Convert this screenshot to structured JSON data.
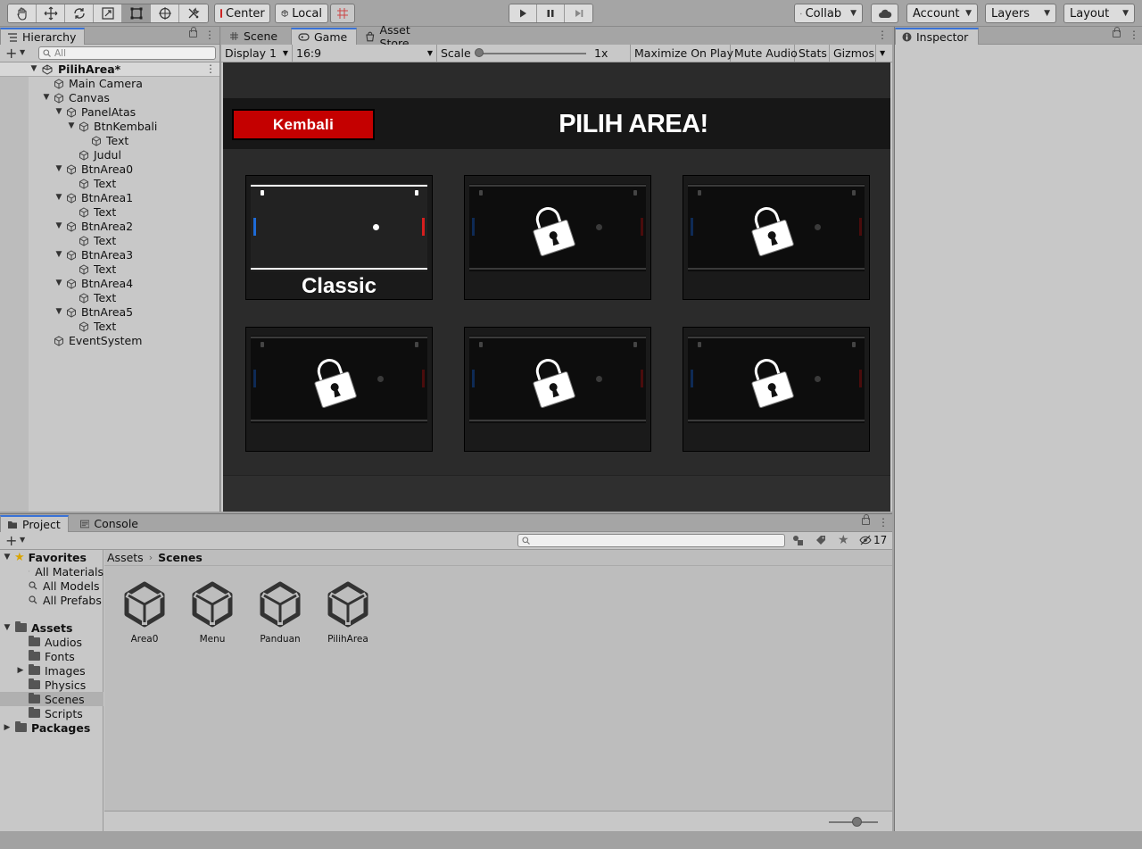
{
  "toolbar": {
    "pivot_label": "Center",
    "space_label": "Local",
    "collab_label": "Collab",
    "account_label": "Account",
    "layers_label": "Layers",
    "layout_label": "Layout"
  },
  "hierarchy": {
    "tab_label": "Hierarchy",
    "search_placeholder": "All",
    "scene_name": "PilihArea*",
    "items": [
      {
        "label": "Main Camera"
      },
      {
        "label": "Canvas"
      },
      {
        "label": "PanelAtas"
      },
      {
        "label": "BtnKembali"
      },
      {
        "label": "Text"
      },
      {
        "label": "Judul"
      },
      {
        "label": "BtnArea0"
      },
      {
        "label": "Text"
      },
      {
        "label": "BtnArea1"
      },
      {
        "label": "Text"
      },
      {
        "label": "BtnArea2"
      },
      {
        "label": "Text"
      },
      {
        "label": "BtnArea3"
      },
      {
        "label": "Text"
      },
      {
        "label": "BtnArea4"
      },
      {
        "label": "Text"
      },
      {
        "label": "BtnArea5"
      },
      {
        "label": "Text"
      },
      {
        "label": "EventSystem"
      }
    ]
  },
  "center_tabs": {
    "scene": "Scene",
    "game": "Game",
    "asset_store": "Asset Store"
  },
  "game_bar": {
    "display": "Display 1",
    "aspect": "16:9",
    "scale_label": "Scale",
    "scale_value": "1x",
    "maximize": "Maximize On Play",
    "mute": "Mute Audio",
    "stats": "Stats",
    "gizmos": "Gizmos"
  },
  "game": {
    "back_button": "Kembali",
    "title": "PILIH AREA!",
    "area0_label": "Classic"
  },
  "inspector": {
    "tab_label": "Inspector"
  },
  "project": {
    "tab_project": "Project",
    "tab_console": "Console",
    "hidden_count": "17",
    "favorites_label": "Favorites",
    "favorites": [
      "All Materials",
      "All Models",
      "All Prefabs"
    ],
    "assets_label": "Assets",
    "folders": [
      "Audios",
      "Fonts",
      "Images",
      "Physics",
      "Scenes",
      "Scripts"
    ],
    "packages_label": "Packages",
    "breadcrumb_root": "Assets",
    "breadcrumb_current": "Scenes",
    "scenes": [
      "Area0",
      "Menu",
      "Panduan",
      "PilihArea"
    ]
  }
}
